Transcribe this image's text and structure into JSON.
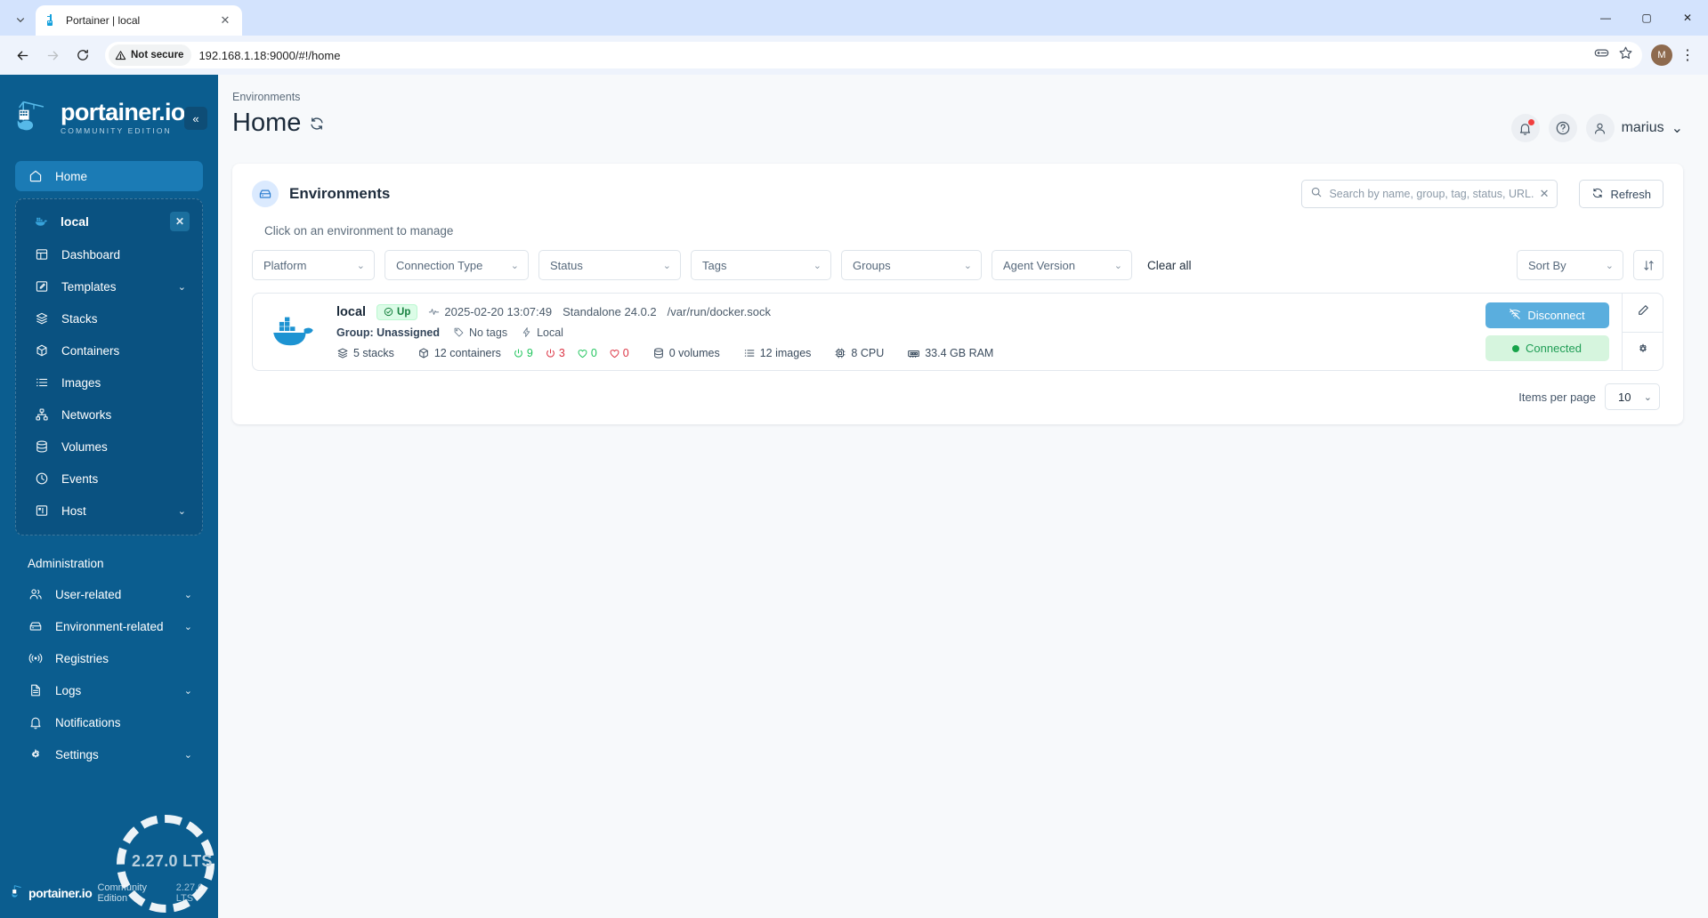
{
  "browser": {
    "tab_title": "Portainer | local",
    "tab_favicon_name": "portainer-favicon",
    "security_label": "Not secure",
    "url": "192.168.1.18:9000/#!/home",
    "back_icon": "←",
    "forward_icon": "→",
    "reload_icon": "⟳",
    "passwords_icon": "key-icon",
    "bookmark_icon": "star-icon",
    "profile_initial": "M",
    "kebab_icon": "⋮",
    "win_minimize": "—",
    "win_maximize": "▢",
    "win_close": "✕",
    "tab_close": "✕",
    "tab_list_icon": "⌄"
  },
  "sidebar": {
    "logo_main": "portainer.io",
    "logo_sub": "COMMUNITY EDITION",
    "collapse_icon": "«",
    "home": {
      "label": "Home",
      "icon": "home-icon"
    },
    "environment": {
      "name": "local",
      "close_icon": "✕",
      "items": [
        {
          "label": "Dashboard",
          "icon": "dashboard-icon",
          "chevron": ""
        },
        {
          "label": "Templates",
          "icon": "templates-icon",
          "chevron": "⌄"
        },
        {
          "label": "Stacks",
          "icon": "stacks-icon",
          "chevron": ""
        },
        {
          "label": "Containers",
          "icon": "containers-icon",
          "chevron": ""
        },
        {
          "label": "Images",
          "icon": "images-icon",
          "chevron": ""
        },
        {
          "label": "Networks",
          "icon": "networks-icon",
          "chevron": ""
        },
        {
          "label": "Volumes",
          "icon": "volumes-icon",
          "chevron": ""
        },
        {
          "label": "Events",
          "icon": "events-icon",
          "chevron": ""
        },
        {
          "label": "Host",
          "icon": "host-icon",
          "chevron": "⌄"
        }
      ]
    },
    "admin_title": "Administration",
    "admin_items": [
      {
        "label": "User-related",
        "icon": "users-icon",
        "chevron": "⌄"
      },
      {
        "label": "Environment-related",
        "icon": "environment-icon",
        "chevron": "⌄"
      },
      {
        "label": "Registries",
        "icon": "registries-icon",
        "chevron": ""
      },
      {
        "label": "Logs",
        "icon": "logs-icon",
        "chevron": "⌄"
      },
      {
        "label": "Notifications",
        "icon": "bell-icon",
        "chevron": ""
      },
      {
        "label": "Settings",
        "icon": "gear-icon",
        "chevron": "⌄"
      }
    ],
    "footer_logo": "portainer.io",
    "footer_edition": "Community Edition",
    "footer_version": "2.27.0 LTS"
  },
  "header": {
    "breadcrumb": "Environments",
    "title": "Home",
    "refresh_icon": "refresh-icon",
    "notifications_icon": "bell-icon",
    "help_icon": "help-icon",
    "user_name": "marius",
    "user_chevron": "⌄"
  },
  "card": {
    "title": "Environments",
    "title_icon": "environment-icon",
    "search_placeholder": "Search by name, group, tag, status, URL...",
    "search_value": "",
    "search_clear": "✕",
    "refresh_label": "Refresh",
    "hint": "Click on an environment to manage",
    "filters": [
      {
        "label": "Platform",
        "name": "platform"
      },
      {
        "label": "Connection Type",
        "name": "connection-type"
      },
      {
        "label": "Status",
        "name": "status"
      },
      {
        "label": "Tags",
        "name": "tags"
      },
      {
        "label": "Groups",
        "name": "groups"
      },
      {
        "label": "Agent Version",
        "name": "agent-version"
      }
    ],
    "clear_all": "Clear all",
    "sort_by": "Sort By",
    "sort_dir_icon": "↓↑",
    "items_per_page_label": "Items per page",
    "items_per_page_value": "10",
    "chevron": "⌄"
  },
  "environment": {
    "name": "local",
    "status_badge": "Up",
    "last_seen": "2025-02-20 13:07:49",
    "engine": "Standalone 24.0.2",
    "socket": "/var/run/docker.sock",
    "group_label": "Group: Unassigned",
    "tags": "No tags",
    "edge_label": "Local",
    "stats": {
      "stacks": "5 stacks",
      "containers": "12 containers",
      "containers_running": "9",
      "containers_stopped": "3",
      "containers_healthy": "0",
      "containers_unhealthy": "0",
      "volumes": "0 volumes",
      "images": "12 images",
      "cpu": "8 CPU",
      "ram": "33.4 GB RAM"
    },
    "disconnect_label": "Disconnect",
    "connected_label": "Connected",
    "edit_icon": "pencil-icon",
    "settings_icon": "gear-icon"
  },
  "colors": {
    "sidebar_bg": "#0b5d8f",
    "sidebar_active": "#1b7bb5",
    "accent_blue": "#5aaede",
    "status_up_bg": "#dcfce7",
    "status_up_text": "#15803d",
    "connected_bg": "#d6f5de",
    "connected_text": "#1f9d55",
    "running_green": "#22c55e",
    "stopped_red": "#dc3545",
    "notification_dot": "#f03e3e"
  }
}
